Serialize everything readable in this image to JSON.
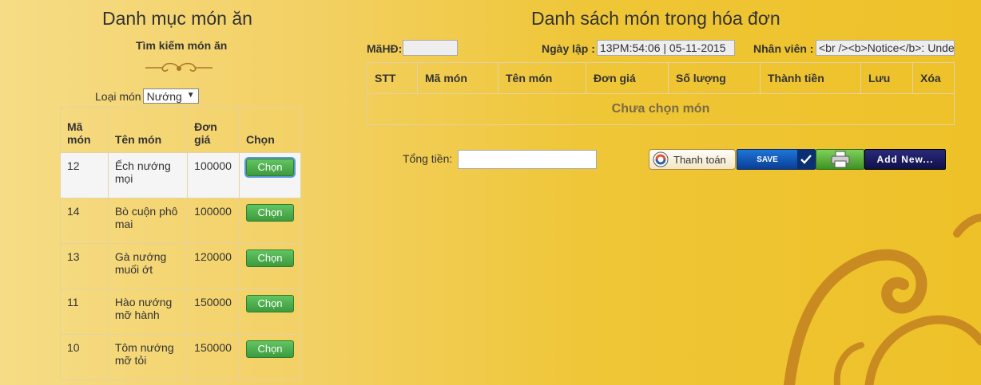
{
  "left_panel": {
    "title": "Danh mục món ăn",
    "search_label": "Tìm kiếm món ăn",
    "category_label": "Loại món",
    "category_value": "Nướng",
    "table": {
      "headers": [
        "Mã món",
        "Tên món",
        "Đơn giá",
        "Chọn"
      ],
      "rows": [
        {
          "id": "12",
          "name": "Ếch nướng mọi",
          "price": "100000",
          "action": "Chọn"
        },
        {
          "id": "14",
          "name": "Bò cuộn phô mai",
          "price": "100000",
          "action": "Chọn"
        },
        {
          "id": "13",
          "name": "Gà nướng muối ớt",
          "price": "120000",
          "action": "Chọn"
        },
        {
          "id": "11",
          "name": "Hào nướng mỡ hành",
          "price": "150000",
          "action": "Chọn"
        },
        {
          "id": "10",
          "name": "Tôm nướng mỡ tỏi",
          "price": "150000",
          "action": "Chọn"
        }
      ]
    }
  },
  "right_panel": {
    "title": "Danh sách món trong hóa đơn",
    "invoice_id_label": "MãHĐ:",
    "invoice_id_value": "",
    "date_label": "Ngày lập :",
    "date_value": "13PM:54:06 | 05-11-2015",
    "staff_label": "Nhân viên :",
    "staff_value": "<br /><b>Notice</b>:  Unde",
    "bill_headers": [
      "STT",
      "Mã món",
      "Tên món",
      "Đơn giá",
      "Số lượng",
      "Thành tiền",
      "Lưu",
      "Xóa"
    ],
    "empty_message": "Chưa chọn món",
    "total_label": "Tổng tiền:",
    "total_value": "",
    "buttons": {
      "pay": "Thanh toán",
      "save": "SAVE",
      "add_new": "Add New..."
    }
  },
  "colors": {
    "background_light": "#f6dc86",
    "background_dark": "#eec128",
    "button_green": "#3d9b3d",
    "save_blue": "#0a3e96",
    "add_new_navy": "#10104a"
  },
  "icons": [
    "ornament-divider-icon",
    "dropdown-arrow-icon",
    "payment-logo-icon",
    "checkmark-icon",
    "printer-icon",
    "swirl-decoration"
  ]
}
